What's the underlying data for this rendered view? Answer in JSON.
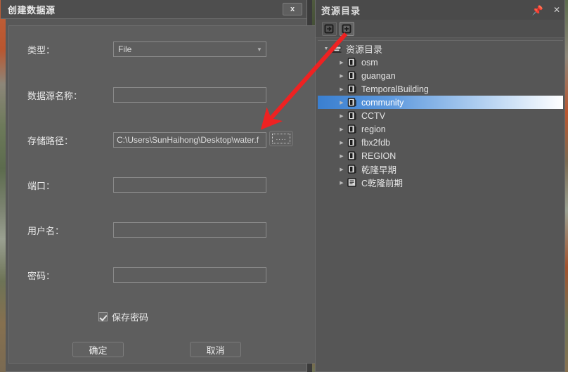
{
  "dialog": {
    "title": "创建数据源",
    "close_label": "x",
    "fields": [
      {
        "label": "类型：",
        "name": "type",
        "kind": "select",
        "value": "File",
        "placeholder": ""
      },
      {
        "label": "数据源名称：",
        "name": "datasource-name",
        "kind": "text",
        "value": "",
        "placeholder": ""
      },
      {
        "label": "存储路径：",
        "name": "storage-path",
        "kind": "text",
        "value": "C:\\Users\\SunHaihong\\Desktop\\water.f",
        "placeholder": ""
      },
      {
        "label": "端口：",
        "name": "port",
        "kind": "text",
        "value": "",
        "placeholder": ""
      },
      {
        "label": "用户名：",
        "name": "username",
        "kind": "text",
        "value": "",
        "placeholder": ""
      },
      {
        "label": "密码：",
        "name": "password",
        "kind": "text",
        "value": "",
        "placeholder": ""
      }
    ],
    "browse_label": "....",
    "save_password": {
      "label": "保存密码",
      "checked": true
    },
    "ok_label": "确定",
    "cancel_label": "取消"
  },
  "resource_panel": {
    "title": "资源目录",
    "pin_icon": "pin-icon",
    "close_icon": "close-icon",
    "toolbar": [
      {
        "name": "connect-datasource-button",
        "icon": "box-arrow-icon"
      },
      {
        "name": "create-datasource-button",
        "icon": "box-plus-icon"
      }
    ],
    "tree": {
      "root": {
        "label": "资源目录",
        "icon": "server-icon"
      },
      "items": [
        {
          "label": "osm",
          "icon": "datasource-icon",
          "selected": false
        },
        {
          "label": "guangan",
          "icon": "datasource-icon",
          "selected": false
        },
        {
          "label": "TemporalBuilding",
          "icon": "datasource-icon",
          "selected": false
        },
        {
          "label": "community",
          "icon": "datasource-icon",
          "selected": true
        },
        {
          "label": "CCTV",
          "icon": "datasource-icon",
          "selected": false
        },
        {
          "label": "region",
          "icon": "datasource-icon",
          "selected": false
        },
        {
          "label": "fbx2fdb",
          "icon": "datasource-icon",
          "selected": false
        },
        {
          "label": "REGION",
          "icon": "datasource-icon",
          "selected": false
        },
        {
          "label": "乾隆早期",
          "icon": "datasource-icon",
          "selected": false
        },
        {
          "label": "C乾隆前期",
          "icon": "file-datasource-icon",
          "selected": false
        }
      ]
    }
  },
  "colors": {
    "dialog_bg": "#585858",
    "panel_bg": "#565656",
    "selection_blue": "#3a7fd0",
    "annotation_red": "#ee2222",
    "text": "#e8e8e8"
  }
}
